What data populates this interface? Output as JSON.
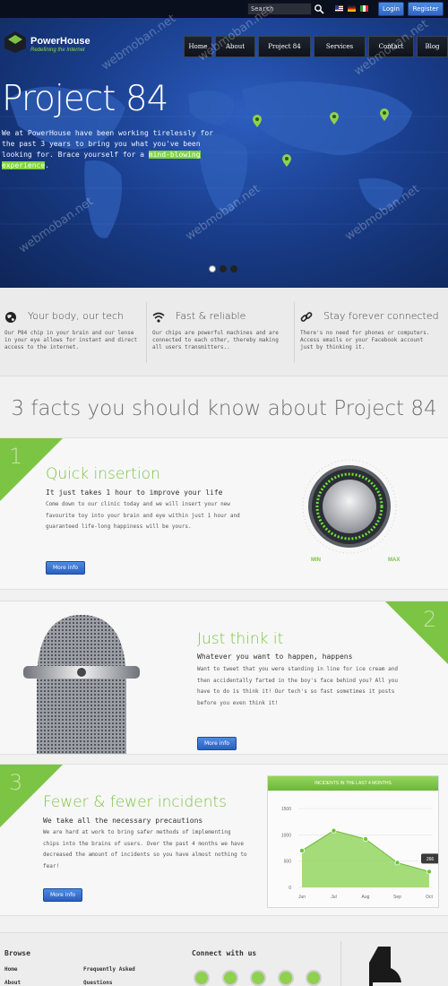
{
  "topbar": {
    "search_value": "Search",
    "login_label": "Login",
    "register_label": "Register",
    "flags": [
      "us-flag-icon",
      "de-flag-icon",
      "it-flag-icon"
    ]
  },
  "brand": {
    "name": "PowerHouse",
    "tagline": "Redefining the Internet"
  },
  "nav": [
    "Home",
    "About",
    "Project 84",
    "Services",
    "Contact",
    "Blog"
  ],
  "hero": {
    "title": "Project 84",
    "text_before": "We at PowerHouse have been working tirelessly for the past 3 years to bring you what you've been looking for. Brace yourself for a ",
    "text_highlight": "mind-blowing experience",
    "text_after": ".",
    "slides": 3,
    "active_slide": 1
  },
  "features": [
    {
      "icon": "globe-icon",
      "title": "Your body, our tech",
      "text": "Our P84 chip in your brain and our lense in your eye allows for instant and direct access to the internet."
    },
    {
      "icon": "wifi-icon",
      "title": "Fast & reliable",
      "text": "Our chips are powerful machines and are connected to each other, thereby making all users transmitters.."
    },
    {
      "icon": "link-icon",
      "title": "Stay forever connected",
      "text": "There's no need for phones or computers. Access emails or your Facebook account just by thinking it."
    }
  ],
  "section_title": "3 facts you should know about Project 84",
  "facts": [
    {
      "number": "1",
      "title": "Quick insertion",
      "subtitle": "It just takes 1 hour to improve your life",
      "text": "Come down to our clinic today and we will insert your new favourite toy into your brain and eye within just 1 hour and guaranteed life-long happiness will be yours.",
      "button": "More info",
      "dial_min": "MIN",
      "dial_max": "MAX"
    },
    {
      "number": "2",
      "title": "Just think it",
      "subtitle": "Whatever you want to happen, happens",
      "text": "Want to tweet that you were standing in line for ice cream and then accidentally farted in the boy's face behind you? All you have to do is think it! Our tech's so fast sometimes it posts before you even think it!",
      "button": "More info"
    },
    {
      "number": "3",
      "title": "Fewer & fewer incidents",
      "subtitle": "We take all the necessary precautions",
      "text": "We are hard at work to bring safer methods of implementing chips into the brains of users. Over the past 4 months we have decreased the amount of incidents so you have almost nothing to fear!",
      "button": "More info"
    }
  ],
  "chart_data": {
    "type": "area",
    "title": "INCIDENTS IN THE LAST 4 MONTHS",
    "categories": [
      "Jun",
      "Jul",
      "Aug",
      "Sep",
      "Oct"
    ],
    "values": [
      700,
      1080,
      920,
      470,
      300
    ],
    "yticks": [
      "1500",
      "1000",
      "500",
      "0"
    ],
    "ylim": [
      0,
      1500
    ],
    "callout": "266",
    "color": "#8fd45a"
  },
  "footer": {
    "browse_heading": "Browse",
    "links_col1": [
      "Home",
      "About"
    ],
    "links_col2": [
      "Frequently Asked",
      "Questions"
    ],
    "connect_heading": "Connect with us",
    "social": [
      "facebook-icon",
      "twitter-icon",
      "skype-icon",
      "linkedin-icon",
      "email-icon"
    ]
  },
  "colors": {
    "accent_green": "#7cc443",
    "button_blue": "#2f63c2",
    "hero_blue": "#1a3f8e"
  }
}
